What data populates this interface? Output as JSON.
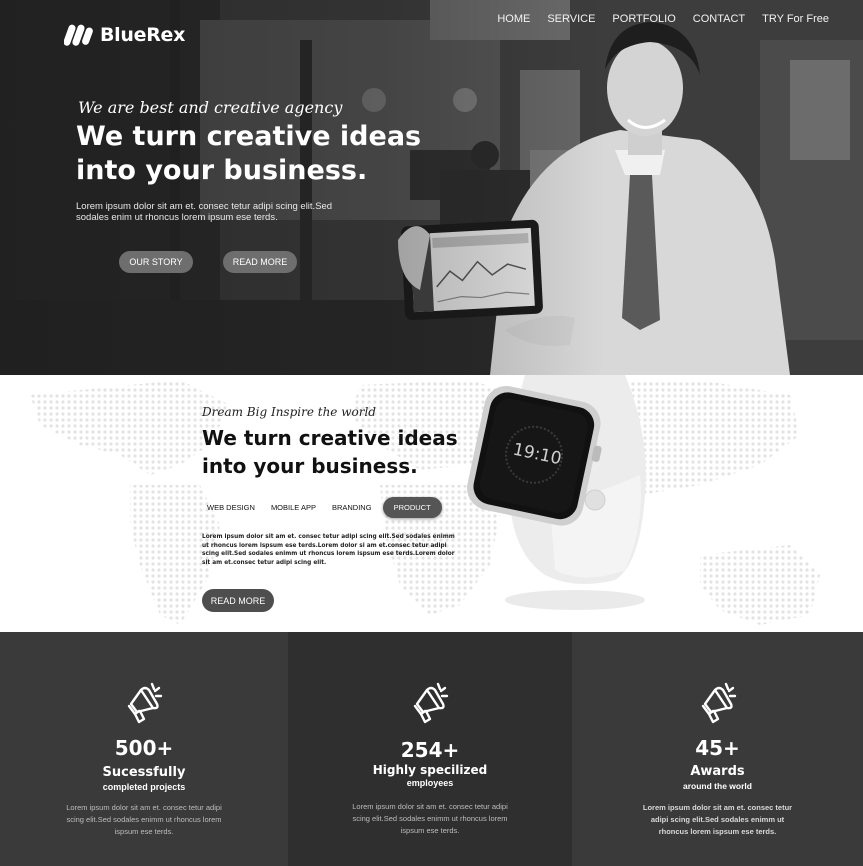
{
  "brand": {
    "name": "BlueRex"
  },
  "nav": [
    {
      "label": "HOME"
    },
    {
      "label": "SERVICE"
    },
    {
      "label": "PORTFOLIO"
    },
    {
      "label": "CONTACT"
    },
    {
      "label": "TRY For Free"
    }
  ],
  "hero": {
    "tagline": "We are best and creative agency",
    "title": "We turn creative ideas into your business.",
    "description": "Lorem ipsum dolor sit am et. consec tetur adipi scing elit.Sed sodales enim ut rhoncus lorem ipsum ese terds.",
    "buttons": {
      "story": "OUR STORY",
      "read_more": "READ MORE"
    }
  },
  "section2": {
    "tagline": "Dream Big Inspire the world",
    "title": "We turn creative ideas into your business.",
    "tabs": [
      {
        "label": "WEB DESIGN"
      },
      {
        "label": "MOBILE APP"
      },
      {
        "label": "BRANDING"
      },
      {
        "label": "PRODUCT"
      }
    ],
    "active_tab": "PRODUCT",
    "watch_time": "19:10",
    "description": "Lorem ipsum dolor sit am et. consec tetur adipi scing elit.Sed sodales enimm ut rhoncus lorem ispsum ese terds.Lorem dolor si am et.consec tetur adipi scing elit.Sed sodales enimm ut rhoncus lorem ispsum ese terds.Lorem dolor sit am et.consec tetur adipi scing elit.",
    "button": "READ MORE"
  },
  "stats": [
    {
      "icon": "megaphone-icon",
      "number": "500+",
      "label": "Sucessfully",
      "sub": "completed projects",
      "description": "Lorem ipsum dolor sit am et. consec tetur adipi scing elit.Sed sodales enimm ut rhoncus lorem ispsum ese terds."
    },
    {
      "icon": "megaphone-icon",
      "number": "254+",
      "label": "Highly specilized",
      "sub": "employees",
      "description": "Lorem ipsum dolor sit am et. consec tetur adipi scing elit.Sed sodales enimm ut rhoncus lorem ispsum ese terds."
    },
    {
      "icon": "megaphone-icon",
      "number": "45+",
      "label": "Awards",
      "sub": "around the world",
      "description": "Lorem ipsum dolor sit am et. consec tetur adipi scing elit.Sed sodales enimm ut rhoncus lorem ispsum ese terds."
    }
  ],
  "colors": {
    "hero_bg": "#4a4a4a",
    "stats_dark": "#2f2f2f",
    "stats_mid": "#3a3a3a",
    "button_gray": "#6e6e6e"
  }
}
